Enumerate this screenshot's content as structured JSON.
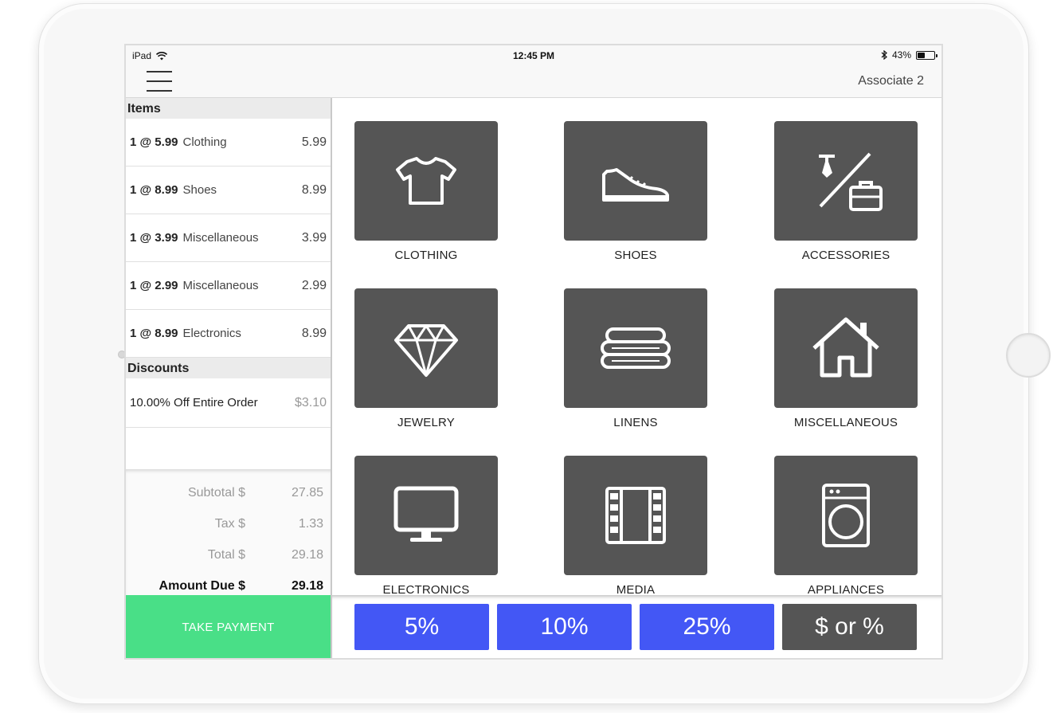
{
  "status_bar": {
    "device": "iPad",
    "time": "12:45 PM",
    "battery": "43%",
    "battery_level": 0.43
  },
  "nav": {
    "associate": "Associate 2"
  },
  "items_section": {
    "title": "Items",
    "items": [
      {
        "qty": "1 @ 5.99",
        "name": "Clothing",
        "price": "5.99"
      },
      {
        "qty": "1 @ 8.99",
        "name": "Shoes",
        "price": "8.99"
      },
      {
        "qty": "1 @ 3.99",
        "name": "Miscellaneous",
        "price": "3.99"
      },
      {
        "qty": "1 @ 2.99",
        "name": "Miscellaneous",
        "price": "2.99"
      },
      {
        "qty": "1 @ 8.99",
        "name": "Electronics",
        "price": "8.99"
      }
    ]
  },
  "discounts_section": {
    "title": "Discounts",
    "items": [
      {
        "name": "10.00% Off Entire Order",
        "amount": "$3.10"
      }
    ]
  },
  "totals": {
    "subtotal_label": "Subtotal $",
    "subtotal": "27.85",
    "tax_label": "Tax $",
    "tax": "1.33",
    "total_label": "Total $",
    "total": "29.18",
    "amount_due_label": "Amount Due $",
    "amount_due": "29.18"
  },
  "take_payment": "TAKE PAYMENT",
  "categories": [
    {
      "label": "CLOTHING",
      "icon": "tshirt-icon"
    },
    {
      "label": "SHOES",
      "icon": "sneaker-icon"
    },
    {
      "label": "ACCESSORIES",
      "icon": "tie-briefcase-icon"
    },
    {
      "label": "JEWELRY",
      "icon": "diamond-icon"
    },
    {
      "label": "LINENS",
      "icon": "folded-linens-icon"
    },
    {
      "label": "MISCELLANEOUS",
      "icon": "house-icon"
    },
    {
      "label": "ELECTRONICS",
      "icon": "monitor-icon"
    },
    {
      "label": "MEDIA",
      "icon": "film-strip-icon"
    },
    {
      "label": "APPLIANCES",
      "icon": "washing-machine-icon"
    }
  ],
  "discount_buttons": [
    "5%",
    "10%",
    "25%",
    "$ or %"
  ],
  "colors": {
    "accent_blue": "#4357f5",
    "tile_gray": "#555555",
    "payment_green": "#49df87"
  }
}
